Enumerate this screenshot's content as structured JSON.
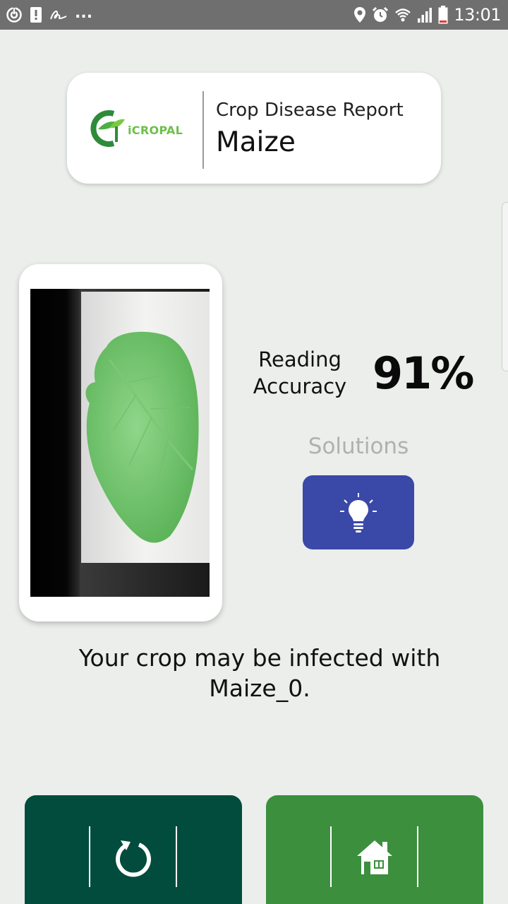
{
  "status_bar": {
    "time": "13:01",
    "left_icons": [
      "sync-icon",
      "alert-icon",
      "signature-icon",
      "more-notifications-icon"
    ],
    "more_text": "...",
    "right_icons": [
      "location-icon",
      "alarm-icon",
      "wifi-icon",
      "signal-icon",
      "battery-icon"
    ]
  },
  "header": {
    "logo_text": "iCROPAL",
    "subtitle": "Crop Disease Report",
    "title": "Maize"
  },
  "accuracy": {
    "label": "Reading Accuracy",
    "value": "91%"
  },
  "solutions": {
    "label": "Solutions",
    "icon": "lightbulb-icon"
  },
  "result": {
    "message": "Your crop may be infected with Maize_0."
  },
  "bottom_bar": {
    "retry_icon": "refresh-icon",
    "home_icon": "home-icon"
  },
  "colors": {
    "background": "#ebeeeb",
    "solutions_button": "#3a48a8",
    "retry_button": "#024c3d",
    "home_button": "#3b8f3d",
    "logo_green": "#6cc04a"
  }
}
